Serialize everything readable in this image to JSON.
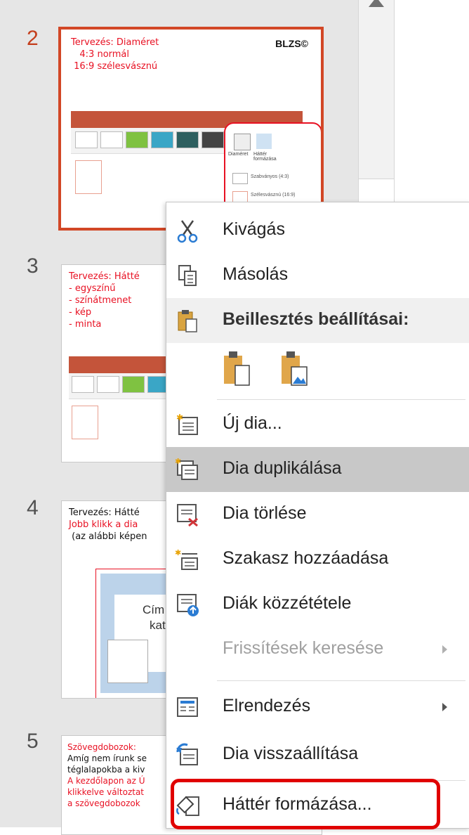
{
  "slides": [
    {
      "number": "2",
      "selected": true,
      "lines": [
        {
          "text": "Tervezés: Diaméret",
          "color": "red"
        },
        {
          "text": "   4:3 normál",
          "color": "red"
        },
        {
          "text": " 16:9 szélesvásznú",
          "color": "red"
        }
      ],
      "logo": "BLZS©",
      "popup": {
        "btn1": "Diaméret",
        "btn2": "Háttér formázása",
        "opt1": "Szabványos (4:3)",
        "opt2": "Szélesvásznú (16:9)"
      }
    },
    {
      "number": "3",
      "lines": [
        {
          "text": "Tervezés: Hátté",
          "color": "red"
        },
        {
          "text": "- egyszínű",
          "color": "red"
        },
        {
          "text": "- színátmenet",
          "color": "red"
        },
        {
          "text": "- kép",
          "color": "red"
        },
        {
          "text": "- minta",
          "color": "red"
        }
      ]
    },
    {
      "number": "4",
      "lines": [
        {
          "text": "Tervezés: Hátté",
          "color": "black"
        },
        {
          "text": "Jobb klikk a dia",
          "color": "red"
        },
        {
          "text": " (az alábbi képen",
          "color": "black"
        }
      ],
      "inner": {
        "title1": "Cím h",
        "title2": "katti"
      }
    },
    {
      "number": "5",
      "lines": [
        {
          "text": "Szövegdobozok:",
          "color": "red"
        },
        {
          "text": "Amíg nem írunk se",
          "color": "black"
        },
        {
          "text": "téglalapokba a kiv",
          "color": "black"
        },
        {
          "text": "A kezdőlapon az Ú",
          "color": "red"
        },
        {
          "text": "klikkelve változtat",
          "color": "red"
        },
        {
          "text": "a szövegdobozok",
          "color": "red"
        }
      ]
    }
  ],
  "context_menu": {
    "cut": "Kivágás",
    "copy": "Másolás",
    "paste_header": "Beillesztés beállításai:",
    "new_slide": "Új dia...",
    "duplicate": "Dia duplikálása",
    "delete": "Dia törlése",
    "add_section": "Szakasz hozzáadása",
    "publish": "Diák közzététele",
    "check_updates": "Frissítések keresése",
    "layout": "Elrendezés",
    "reset": "Dia visszaállítása",
    "format_bg": "Háttér formázása..."
  },
  "colors": {
    "accent": "#d24726",
    "highlight_box": "#e00000",
    "menu_hover": "#c8c8c8"
  }
}
